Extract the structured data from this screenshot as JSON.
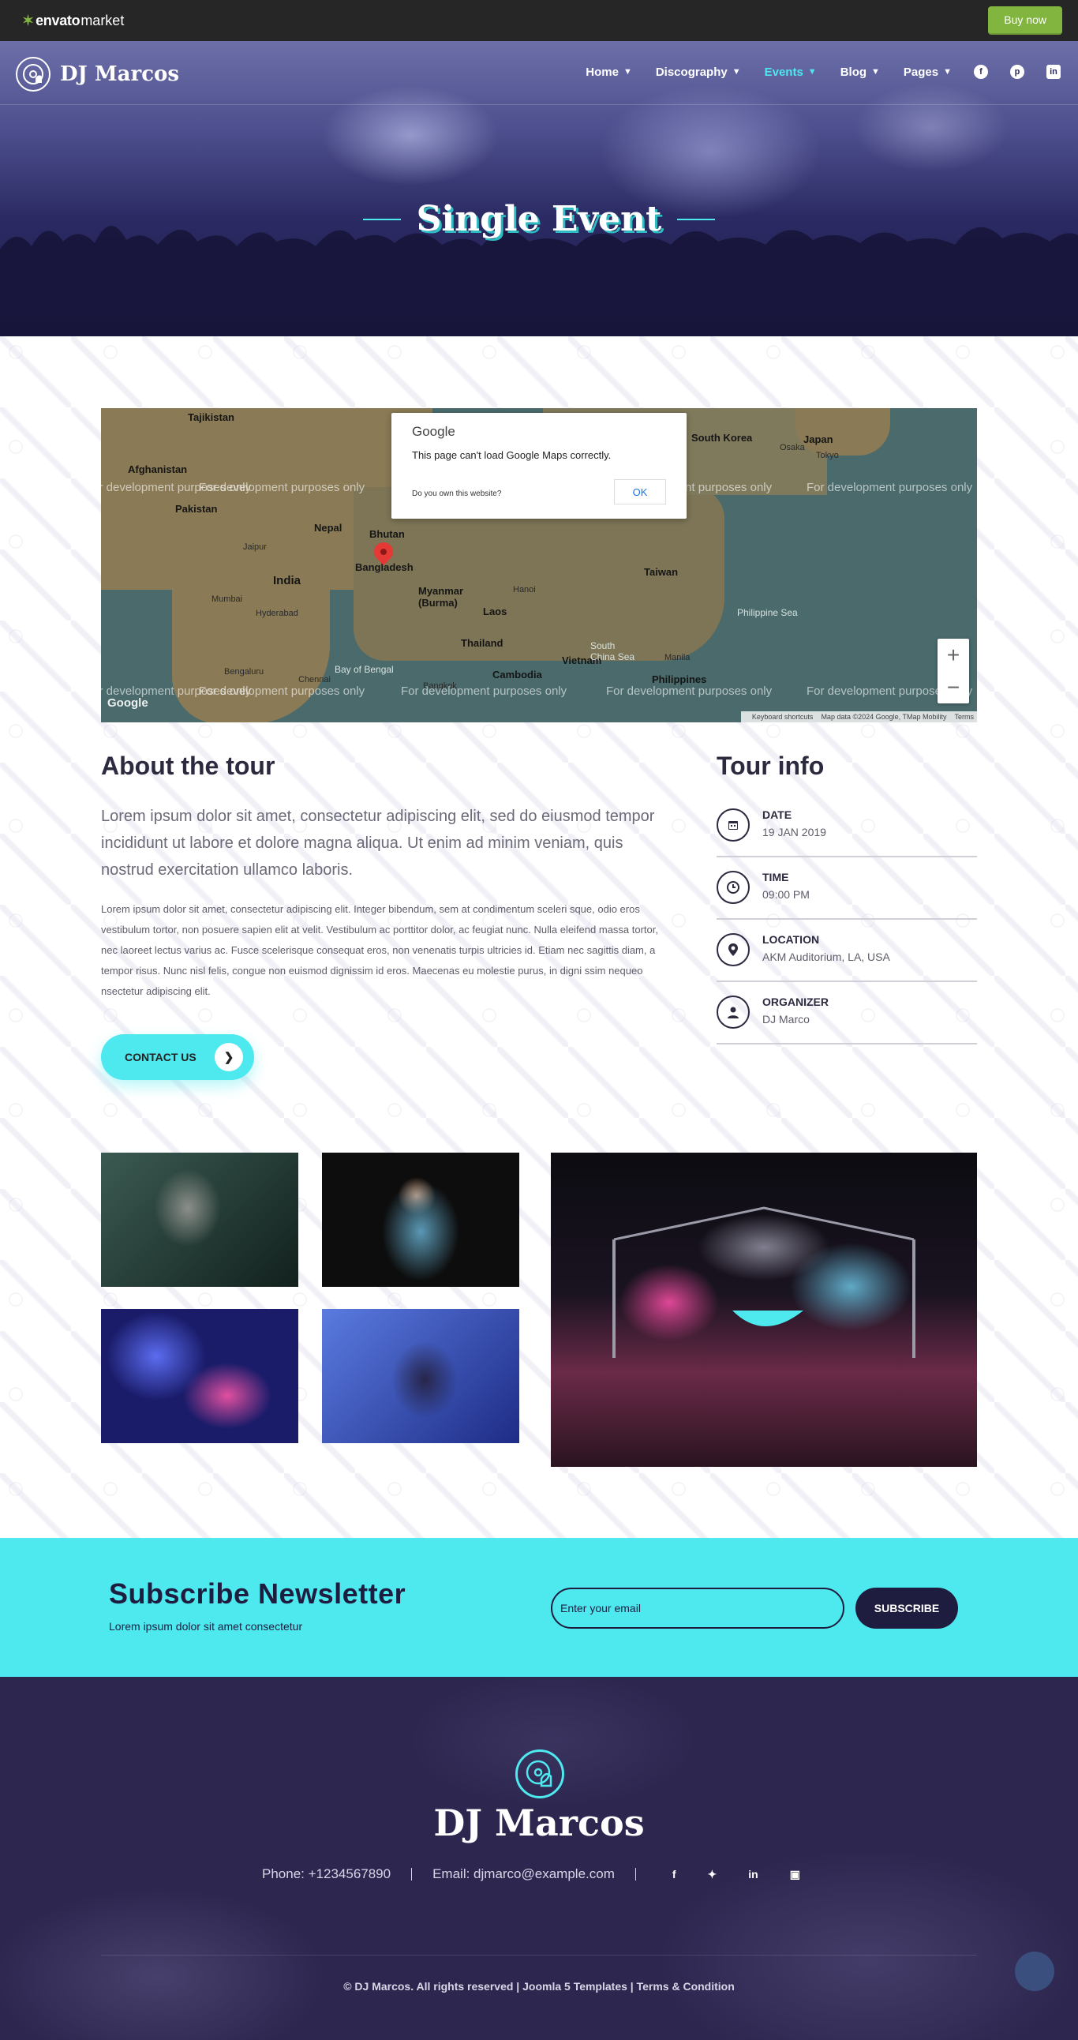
{
  "envato": {
    "logo_main": "envato",
    "logo_sub": "market",
    "buy_label": "Buy now"
  },
  "header": {
    "brand": "DJ Marcos",
    "nav": [
      {
        "label": "Home",
        "dropdown": true,
        "active": false
      },
      {
        "label": "Discography",
        "dropdown": true,
        "active": false
      },
      {
        "label": "Events",
        "dropdown": true,
        "active": true
      },
      {
        "label": "Blog",
        "dropdown": true,
        "active": false
      },
      {
        "label": "Pages",
        "dropdown": true,
        "active": false
      }
    ],
    "social_icons": [
      "facebook-icon",
      "pinterest-icon",
      "linkedin-icon"
    ]
  },
  "hero": {
    "title": "Single Event"
  },
  "map": {
    "dialog_brand": "Google",
    "dialog_message": "This page can't load Google Maps correctly.",
    "dialog_question": "Do you own this website?",
    "dialog_ok": "OK",
    "watermark": "For development purposes only",
    "places": {
      "tajikistan": "Tajikistan",
      "afghanistan": "Afghanistan",
      "pakistan": "Pakistan",
      "nepal": "Nepal",
      "bhutan": "Bhutan",
      "jaipur": "Jaipur",
      "india": "India",
      "bangladesh": "Bangladesh",
      "myanmar": "Myanmar\n(Burma)",
      "laos": "Laos",
      "thailand": "Thailand",
      "vietnam": "Vietnam",
      "cambodia": "Cambodia",
      "mumbai": "Mumbai",
      "hyderabad": "Hyderabad",
      "bengaluru": "Bengaluru",
      "chennai": "Chennai",
      "south_korea": "South Korea",
      "japan": "Japan",
      "osaka": "Osaka",
      "tokyo": "Tokyo",
      "taiwan": "Taiwan",
      "philippines": "Philippines",
      "manila": "Manila",
      "bangkok": "Bangkok",
      "hanoi": "Hanoi",
      "bay_of_bengal": "Bay of Bengal",
      "philippine_sea": "Philippine Sea",
      "south_china_sea": "South\nChina Sea"
    },
    "zoom_in": "+",
    "zoom_out": "−",
    "footer_shortcuts": "Keyboard shortcuts",
    "footer_data": "Map data ©2024 Google, TMap Mobility",
    "footer_terms": "Terms"
  },
  "about": {
    "title": "About the tour",
    "lead": "Lorem ipsum dolor sit amet, consectetur adipiscing elit, sed do eiusmod tempor incididunt ut labore et dolore magna aliqua. Ut enim ad minim veniam, quis nostrud exercitation ullamco laboris.",
    "body": "Lorem ipsum dolor sit amet, consectetur adipiscing elit. Integer bibendum, sem at condimentum sceleri sque, odio eros vestibulum tortor, non posuere sapien elit at velit. Vestibulum ac porttitor dolor, ac feugiat nunc. Nulla eleifend massa tortor, nec laoreet lectus varius ac. Fusce scelerisque consequat eros, non venenatis turpis ultricies id. Etiam nec sagittis diam, a tempor risus. Nunc nisl felis, congue non euismod dignissim id eros. Maecenas eu molestie purus, in digni ssim nequeo nsectetur adipiscing elit.",
    "contact_label": "CONTACT US"
  },
  "tour_info": {
    "title": "Tour info",
    "rows": [
      {
        "icon": "calendar-icon",
        "label": "DATE",
        "value": "19 JAN 2019"
      },
      {
        "icon": "clock-icon",
        "label": "TIME",
        "value": "09:00 PM"
      },
      {
        "icon": "location-pin-icon",
        "label": "LOCATION",
        "value": "AKM Auditorium, LA, USA"
      },
      {
        "icon": "user-icon",
        "label": "ORGANIZER",
        "value": "DJ Marco"
      }
    ]
  },
  "subscribe": {
    "title": "Subscribe Newsletter",
    "description": "Lorem ipsum dolor sit amet consectetur",
    "placeholder": "Enter your email",
    "button": "SUBSCRIBE"
  },
  "footer": {
    "brand": "DJ Marcos",
    "phone": "Phone: +1234567890",
    "email": "Email: djmarco@example.com",
    "social_icons": [
      "facebook-icon",
      "twitter-icon",
      "linkedin-icon",
      "instagram-icon"
    ],
    "copyright": "© DJ Marcos. All rights reserved | Joomla 5 Templates | Terms & Condition"
  },
  "colors": {
    "accent": "#4ee8ef",
    "dark": "#1f1d3f",
    "envato_green": "#82b440",
    "footer_bg": "#2d2750"
  }
}
